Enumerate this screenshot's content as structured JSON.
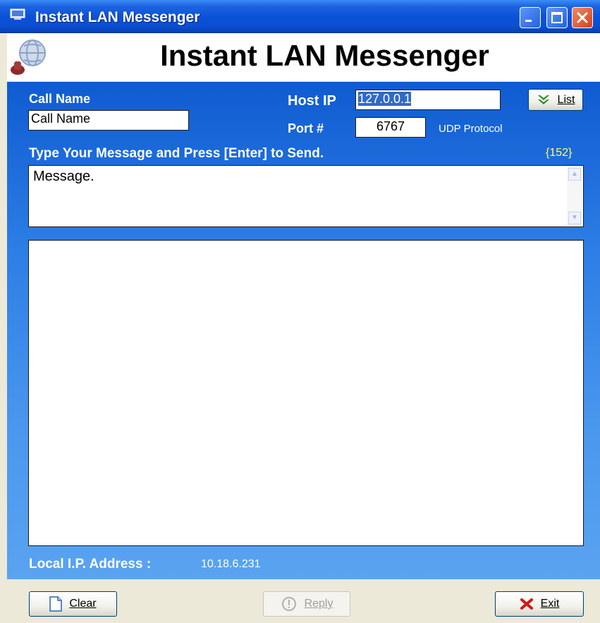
{
  "window": {
    "title": "Instant LAN Messenger"
  },
  "header": {
    "title": "Instant LAN Messenger"
  },
  "form": {
    "call_name_label": "Call Name",
    "call_name_value": "Call Name",
    "host_ip_label": "Host IP",
    "host_ip_value": "127.0.0.1",
    "list_button": "List",
    "port_label": "Port #",
    "port_value": "6767",
    "protocol": "UDP Protocol",
    "message_label": "Type Your Message and Press [Enter] to Send.",
    "char_count": "{152}",
    "message_value": "Message.",
    "local_ip_label": "Local I.P. Address :",
    "local_ip_value": "10.18.6.231"
  },
  "footer": {
    "clear_button": "Clear",
    "reply_button": "Reply",
    "exit_button": "Exit"
  },
  "colors": {
    "titlebar": "#0a50d8",
    "panel_top": "#0f5bd1",
    "panel_bottom": "#5aa3f0",
    "char_count": "#ffff66"
  }
}
